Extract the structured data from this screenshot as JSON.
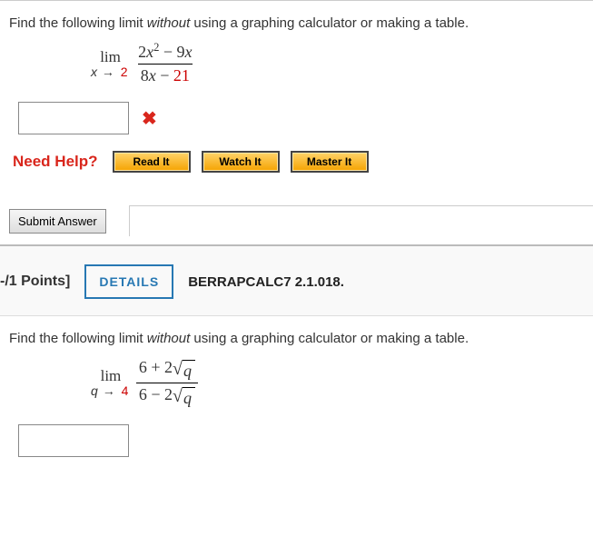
{
  "q1": {
    "prompt_a": "Find the following limit ",
    "prompt_em": "without",
    "prompt_b": " using a graphing calculator or making a table.",
    "lim_word": "lim",
    "sub_var": "x",
    "sub_arrow": "→",
    "sub_val": "2",
    "num_a": "2",
    "num_var1": "x",
    "num_exp": "2",
    "num_b": " − 9",
    "num_var2": "x",
    "den_a": "8",
    "den_var": "x",
    "den_b": " − ",
    "den_c": "21",
    "need_help": "Need Help?",
    "read": "Read It",
    "watch": "Watch It",
    "master": "Master It",
    "submit": "Submit Answer"
  },
  "q2": {
    "points": "-/1 Points]",
    "details": "DETAILS",
    "ref": "BERRAPCALC7 2.1.018.",
    "prompt_a": "Find the following limit ",
    "prompt_em": "without",
    "prompt_b": " using a graphing calculator or making a table.",
    "lim_word": "lim",
    "sub_var": "q",
    "sub_arrow": "→",
    "sub_val": "4",
    "num_a": "6 + 2",
    "num_sqrt": "q",
    "den_a": "6 − 2",
    "den_sqrt": "q"
  }
}
